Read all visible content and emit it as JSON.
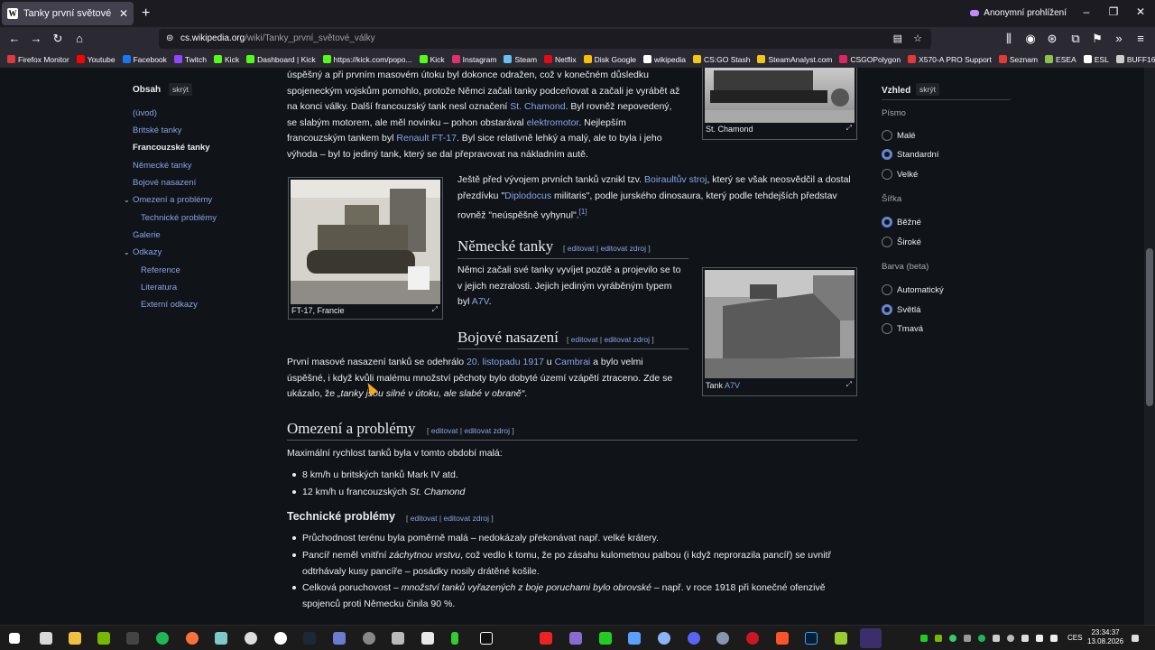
{
  "browser": {
    "tab_title": "Tanky první světové války – Wiki",
    "tab_close": "✕",
    "new_tab": "+",
    "private_label": "Anonymní prohlížení",
    "url_host": "cs.wikipedia.org",
    "url_path": "/wiki/Tanky_první_světové_války",
    "bookmarks": [
      {
        "label": "Firefox Monitor",
        "color": "#e03a3e"
      },
      {
        "label": "Youtube",
        "color": "#ff0000"
      },
      {
        "label": "Facebook",
        "color": "#1877f2"
      },
      {
        "label": "Twitch",
        "color": "#9146ff"
      },
      {
        "label": "Kick",
        "color": "#53fc18"
      },
      {
        "label": "Dashboard | Kick",
        "color": "#53fc18"
      },
      {
        "label": "https://kick.com/popo...",
        "color": "#53fc18"
      },
      {
        "label": "Kick",
        "color": "#53fc18"
      },
      {
        "label": "Instagram",
        "color": "#e1306c"
      },
      {
        "label": "Steam",
        "color": "#66c0f4"
      },
      {
        "label": "Netflix",
        "color": "#e50914"
      },
      {
        "label": "Disk Google",
        "color": "#fbbc04"
      },
      {
        "label": "wikipedia",
        "color": "#ffffff"
      },
      {
        "label": "CS:GO Stash",
        "color": "#f5c518"
      },
      {
        "label": "SteamAnalyst.com",
        "color": "#f5c518"
      },
      {
        "label": "CSGOPolygon",
        "color": "#e0245e"
      },
      {
        "label": "X570-A PRO Support",
        "color": "#e53935"
      },
      {
        "label": "Seznam",
        "color": "#e53935"
      },
      {
        "label": "ESEA",
        "color": "#8bc34a"
      },
      {
        "label": "ESL",
        "color": "#ffffff"
      },
      {
        "label": "BUFF163",
        "color": "#cccccc"
      }
    ]
  },
  "toc": {
    "heading": "Obsah",
    "hide": "skrýt",
    "items": [
      {
        "label": "(úvod)"
      },
      {
        "label": "Britské tanky"
      },
      {
        "label": "Francouzské tanky"
      },
      {
        "label": "Německé tanky"
      },
      {
        "label": "Bojové nasazení"
      },
      {
        "label": "Omezení a problémy"
      },
      {
        "label": "Technické problémy"
      },
      {
        "label": "Galerie"
      },
      {
        "label": "Odkazy"
      },
      {
        "label": "Reference"
      },
      {
        "label": "Literatura"
      },
      {
        "label": "Externí odkazy"
      }
    ]
  },
  "article": {
    "p1_l1": "úspěšný a při prvním masovém útoku byl dokonce odražen, což v konečném důsledku",
    "p1_l2": "spojeneckým vojskům pomohlo, protože Němci začali tanky podceňovat a začali je vyrábět až",
    "p1_l3a": "na konci války. Další francouzský tank nesl označení ",
    "p1_l3link": "St. Chamond",
    "p1_l3b": ". Byl rovněž nepovedený,",
    "p1_l4a": "se slabým motorem, ale měl novinku – pohon obstarával ",
    "p1_l4link": "elektromotor",
    "p1_l4b": ". Nejlepším",
    "p1_l5a": "francouzským tankem byl ",
    "p1_l5link": "Renault FT-17",
    "p1_l5b": ". Byl sice relativně lehký a malý, ale to byla i jeho",
    "p1_l6": "výhoda – byl to jediný tank, který se dal přepravovat na nákladním autě.",
    "p2_l1a": "Ještě před vývojem prvních tanků vznikl tzv. ",
    "p2_l1link": "Boiraultův stroj",
    "p2_l1b": ", který se však neosvědčil a dostal",
    "p2_l2a": "přezdívku \"",
    "p2_l2link": "Diplodocus",
    "p2_l2b": " militaris\", podle jurského dinosaura, který podle tehdejších představ",
    "p2_l3": "rovněž \"neúspěšně vyhynul\".",
    "p2_ref": "[1]",
    "h_nemecke": "Německé tanky",
    "p3_l1": "Němci začali své tanky vyvíjet pozdě a projevilo se to",
    "p3_l2": "v jejich nezralosti. Jejich jediným vyráběným typem",
    "p3_l3a": "byl ",
    "p3_l3link": "A7V",
    "p3_l3b": ".",
    "h_bojove": "Bojové nasazení",
    "p4_l1a": "První masové nasazení tanků se odehrálo ",
    "p4_l1link1": "20. listopadu 1917",
    "p4_l1mid": " u ",
    "p4_l1link2": "Cambrai",
    "p4_l1b": " a bylo velmi",
    "p4_l2": "úspěšné, i když kvůli malému množství pěchoty bylo dobyté území vzápětí ztraceno. Zde se",
    "p4_l3a": "ukázalo, že ",
    "p4_l3i": "„tanky jsou silné v útoku, ale slabé v obraně“",
    "p4_l3b": ".",
    "h_omezeni": "Omezení a problémy",
    "p5": "Maximální rychlost tanků byla v tomto období malá:",
    "b1": "8 km/h u britských tanků Mark IV atd.",
    "b2a": "12 km/h u francouzských ",
    "b2i": "St. Chamond",
    "h_technicke": "Technické problémy",
    "t1": "Průchodnost terénu byla poměrně malá – nedokázaly překonávat např. velké krátery.",
    "t2_l1a": "Pancíř neměl vnitřní ",
    "t2_l1i": "záchytnou vrstvu",
    "t2_l1b": ", což vedlo k tomu, že po zásahu kulometnou palbou (i když neprorazila pancíř) se uvnitř",
    "t2_l2": "odtrhávaly kusy pancíře – posádky nosily drátěné košile.",
    "t3_l1a": "Celková poruchovost – ",
    "t3_l1i": "množství tanků vyřazených z boje poruchami bylo obrovské",
    "t3_l1b": " – např. v roce 1918 při konečné ofenzivě",
    "t3_l2": "spojenců proti Německu činila 90 %.",
    "edit_open": "[",
    "edit_a": "editovat",
    "edit_sep": " | ",
    "edit_b": "editovat zdroj",
    "edit_close": "]"
  },
  "figures": {
    "stchamond": "St. Chamond",
    "ft17": "FT-17, Francie",
    "a7v_prefix": "Tank ",
    "a7v_link": "A7V"
  },
  "appearance": {
    "heading": "Vzhled",
    "hide": "skrýt",
    "font_group": "Písmo",
    "font_options": [
      "Malé",
      "Standardní",
      "Velké"
    ],
    "width_group": "Šířka",
    "width_options": [
      "Běžné",
      "Široké"
    ],
    "color_group": "Barva (beta)",
    "color_options": [
      "Automatický",
      "Světlá",
      "Tmavá"
    ]
  },
  "taskbar": {
    "lang": "CES",
    "time": "23:34:37",
    "date": "13.08.2026"
  }
}
